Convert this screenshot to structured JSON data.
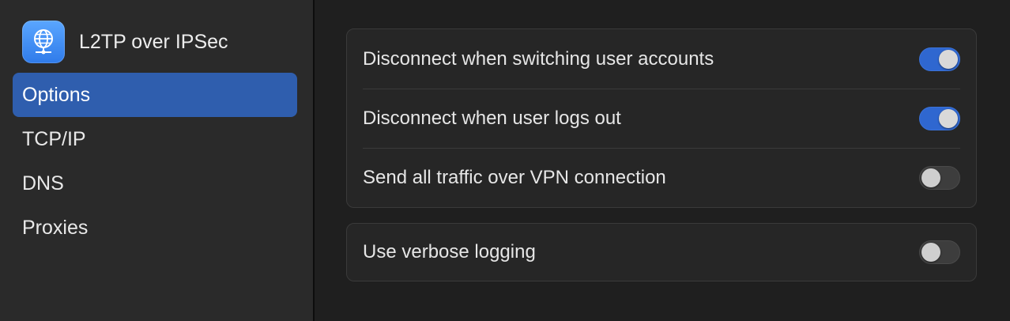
{
  "sidebar": {
    "app_title": "L2TP over IPSec",
    "app_icon": "globe-network-icon",
    "items": [
      {
        "label": "Options",
        "selected": true
      },
      {
        "label": "TCP/IP",
        "selected": false
      },
      {
        "label": "DNS",
        "selected": false
      },
      {
        "label": "Proxies",
        "selected": false
      }
    ]
  },
  "options": {
    "group1": [
      {
        "label": "Disconnect when switching user accounts",
        "enabled": true
      },
      {
        "label": "Disconnect when user logs out",
        "enabled": true
      },
      {
        "label": "Send all traffic over VPN connection",
        "enabled": false
      }
    ],
    "group2": [
      {
        "label": "Use verbose logging",
        "enabled": false
      }
    ]
  },
  "colors": {
    "accent": "#2f67d0",
    "selection": "#2f5eae"
  }
}
